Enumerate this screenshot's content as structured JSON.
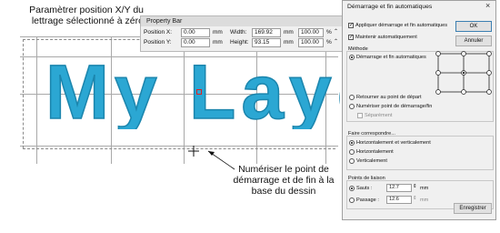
{
  "callouts": {
    "position_line1": "Paramètrer position X/Y du",
    "position_line2": "lettrage sélectionné à zéro",
    "digitize_line1": "Numériser le point de",
    "digitize_line2": "démarrage et de fin à la",
    "digitize_line3": "base du dessin"
  },
  "canvas": {
    "lettering_text": "My Layout",
    "lettering_color": "#2ba7d3"
  },
  "property_bar": {
    "title": "Property Bar",
    "position_x_label": "Position X:",
    "position_x_value": "0.00",
    "position_y_label": "Position Y:",
    "position_y_value": "0.00",
    "unit": "mm",
    "width_label": "Width:",
    "width_value": "169.92",
    "height_label": "Height:",
    "height_value": "93.15",
    "scale_x_value": "100.00",
    "scale_y_value": "100.00",
    "percent": "%"
  },
  "dialog": {
    "title": "Démarrage et fin automatiques",
    "close": "×",
    "ok_label": "OK",
    "cancel_label": "Annuler",
    "apply_label": "Appliquer démarrage et fin automatiques",
    "maintain_label": "Maintenir automatiquement",
    "method_header": "Méthode",
    "method_auto": "Démarrage et fin automatiques",
    "return_start": "Retourner au point de départ",
    "digitize_start": "Numériser point de démarrage/fin",
    "separate": "Séparément",
    "match_header": "Faire correspondre...",
    "match_both": "Horizontalement et verticalement",
    "match_horizontal": "Horizontalement",
    "match_vertical": "Verticalement",
    "tie_header": "Points de liaison",
    "jumps_label": "Sauts :",
    "jumps_value": "12.7",
    "jumps_unit": "mm",
    "passage_label": "Passage :",
    "passage_value": "12.6",
    "passage_unit": "mm",
    "save_label": "Enregistrer"
  }
}
